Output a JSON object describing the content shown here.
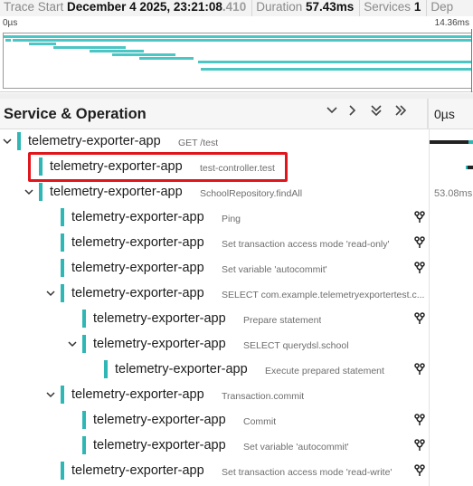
{
  "header": {
    "trace_start_label": "Trace Start",
    "trace_start_value": "December 4 2025, 23:21:08",
    "trace_start_ms": ".410",
    "duration_label": "Duration",
    "duration_value": "57.43ms",
    "services_label": "Services",
    "services_value": "1",
    "depth_label": "Dep"
  },
  "minimap": {
    "start_tick": "0µs",
    "end_tick": "14.36ms"
  },
  "columns": {
    "service_operation": "Service & Operation",
    "timeline_zero": "0µs"
  },
  "controls": {
    "collapse_one": "⌄",
    "expand_one": "›",
    "collapse_all": "⌄⌄",
    "expand_all": "»"
  },
  "spans": [
    {
      "service": "telemetry-exporter-app",
      "operation": "GET /test",
      "depth": 0,
      "expanded": true,
      "fork": false
    },
    {
      "service": "telemetry-exporter-app",
      "operation": "test-controller.test",
      "depth": 1,
      "expanded": null,
      "fork": false,
      "highlighted": true
    },
    {
      "service": "telemetry-exporter-app",
      "operation": "SchoolRepository.findAll",
      "depth": 1,
      "expanded": true,
      "fork": false
    },
    {
      "service": "telemetry-exporter-app",
      "operation": "Ping",
      "depth": 2,
      "expanded": null,
      "fork": true
    },
    {
      "service": "telemetry-exporter-app",
      "operation": "Set transaction access mode 'read-only'",
      "depth": 2,
      "expanded": null,
      "fork": true
    },
    {
      "service": "telemetry-exporter-app",
      "operation": "Set variable 'autocommit'",
      "depth": 2,
      "expanded": null,
      "fork": true
    },
    {
      "service": "telemetry-exporter-app",
      "operation": "SELECT com.example.telemetryexportertest.c...",
      "depth": 2,
      "expanded": true,
      "fork": false
    },
    {
      "service": "telemetry-exporter-app",
      "operation": "Prepare statement",
      "depth": 3,
      "expanded": null,
      "fork": true
    },
    {
      "service": "telemetry-exporter-app",
      "operation": "SELECT querydsl.school",
      "depth": 3,
      "expanded": true,
      "fork": false
    },
    {
      "service": "telemetry-exporter-app",
      "operation": "Execute prepared statement",
      "depth": 4,
      "expanded": null,
      "fork": true
    },
    {
      "service": "telemetry-exporter-app",
      "operation": "Transaction.commit",
      "depth": 2,
      "expanded": true,
      "fork": false
    },
    {
      "service": "telemetry-exporter-app",
      "operation": "Commit",
      "depth": 3,
      "expanded": null,
      "fork": true
    },
    {
      "service": "telemetry-exporter-app",
      "operation": "Set variable 'autocommit'",
      "depth": 3,
      "expanded": null,
      "fork": true
    },
    {
      "service": "telemetry-exporter-app",
      "operation": "Set transaction access mode 'read-write'",
      "depth": 2,
      "expanded": null,
      "fork": true
    }
  ],
  "timeline": {
    "label_row3": "53.08ms"
  },
  "colors": {
    "service_accent": "#2fb7b5",
    "highlight": "#e0161d"
  }
}
